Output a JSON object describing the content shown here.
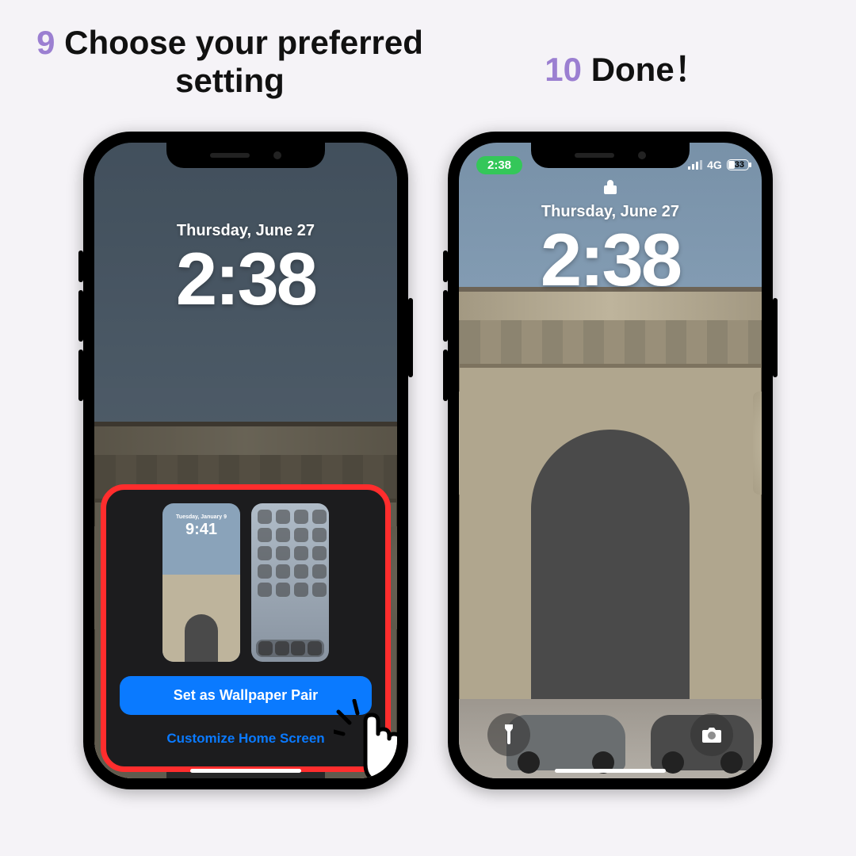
{
  "steps": {
    "left": {
      "num": "9",
      "title": "Choose your preferred setting"
    },
    "right": {
      "num": "10",
      "title": "Done！"
    }
  },
  "lockscreen": {
    "date": "Thursday, June 27",
    "time": "2:38"
  },
  "status": {
    "pill_time": "2:38",
    "network": "4G",
    "battery": "33"
  },
  "sheet": {
    "set_pair_label": "Set as Wallpaper Pair",
    "customize_label": "Customize Home Screen",
    "preview_date": "Tuesday, January 9",
    "preview_time": "9:41"
  },
  "icons": {
    "flashlight": "flashlight-icon",
    "camera": "camera-icon",
    "lock": "lock-icon",
    "signal": "signal-icon"
  }
}
